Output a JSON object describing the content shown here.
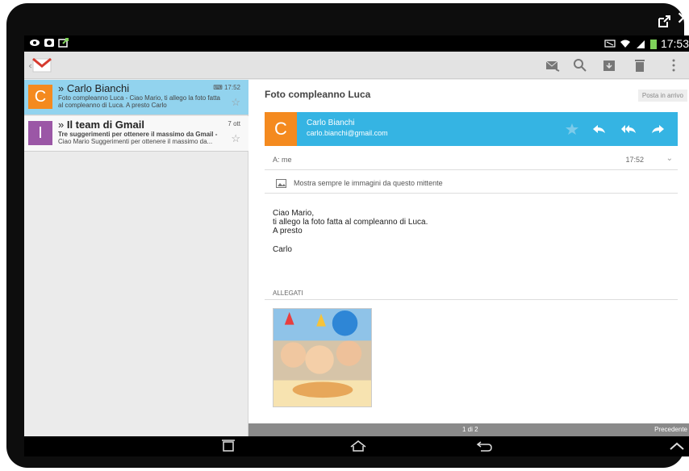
{
  "status": {
    "time": "17:53"
  },
  "list": {
    "items": [
      {
        "avatar_letter": "C",
        "avatar_color": "#f48a1f",
        "sender": "Carlo Bianchi",
        "time": "17:52",
        "snippet": "Foto compleanno Luca - Ciao Mario, ti allego la foto fatta al compleanno di Luca. A presto Carlo"
      },
      {
        "avatar_letter": "I",
        "avatar_color": "#9b57a6",
        "sender": "Il team di Gmail",
        "time": "7 ott",
        "subject": "Tre suggerimenti per ottenere il massimo da Gmail -",
        "snippet": "Ciao Mario Suggerimenti per ottenere il massimo da..."
      }
    ]
  },
  "message": {
    "subject": "Foto compleanno Luca",
    "label": "Posta in arrivo",
    "avatar_letter": "C",
    "from_name": "Carlo Bianchi",
    "from_email": "carlo.bianchi@gmail.com",
    "to": "A: me",
    "time": "17:52",
    "image_notice": "Mostra sempre le immagini da questo mittente",
    "body_lines": [
      "Ciao Mario,",
      "ti allego la foto fatta al compleanno di Luca.",
      "A presto"
    ],
    "signature": "Carlo",
    "attachments_label": "ALLEGATI"
  },
  "pager": {
    "count": "1 di 2",
    "prev": "Precedente"
  },
  "colors": {
    "accent_blue": "#35b4e3",
    "selected_row": "#92d3ee",
    "orange": "#f48a1f",
    "purple": "#9b57a6"
  }
}
